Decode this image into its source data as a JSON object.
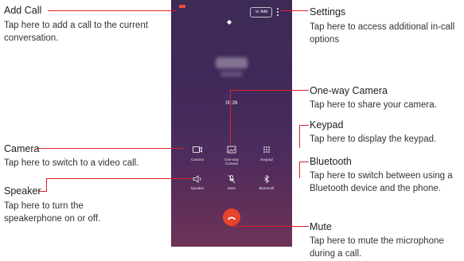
{
  "callouts": {
    "add_call": {
      "title": "Add Call",
      "desc": "Tap here to add a call to the current conversation."
    },
    "settings": {
      "title": "Settings",
      "desc": "Tap here to access additional in-call options"
    },
    "one_way_camera": {
      "title": "One-way Camera",
      "desc": "Tap here to share your camera."
    },
    "keypad": {
      "title": "Keypad",
      "desc": "Tap here to display the keypad."
    },
    "camera": {
      "title": "Camera",
      "desc": "Tap here to switch to a video call."
    },
    "bluetooth": {
      "title": "Bluetooth",
      "desc": "Tap here to switch between using a Bluetooth device and the phone."
    },
    "speaker": {
      "title": "Speaker",
      "desc": "Tap here to turn the speakerphone on or off."
    },
    "mute": {
      "title": "Mute",
      "desc": "Tap here to mute the microphone during a call."
    }
  },
  "phone": {
    "add_button_label": "Add",
    "timer": "00:26",
    "controls": {
      "camera": "Camera",
      "one_way_camera": "One-way Camera",
      "keypad": "Keypad",
      "speaker": "Speaker",
      "mute": "Mute",
      "bluetooth": "Bluetooth"
    }
  },
  "colors": {
    "accent_line": "#d8232a",
    "end_call": "#e8432d",
    "phone_bg": "#41295a"
  }
}
